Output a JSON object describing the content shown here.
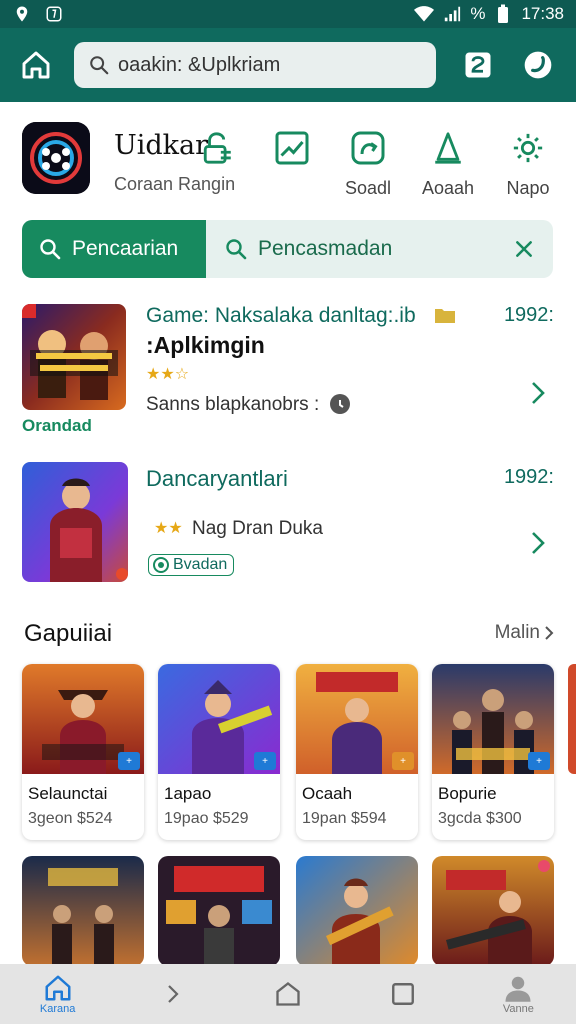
{
  "status_bar": {
    "battery": "%",
    "time": "17:38"
  },
  "appbar": {
    "search_value": "oaakin: &Uplkriam"
  },
  "header": {
    "title": "Uidkar",
    "subtitle": "Coraan Rangin"
  },
  "shortcuts": [
    {
      "label": "",
      "icon": "lock-icon"
    },
    {
      "label": "",
      "icon": "chart-icon"
    },
    {
      "label": "Soadl",
      "icon": "refresh-icon"
    },
    {
      "label": "Aoaah",
      "icon": "triangle-icon"
    },
    {
      "label": "Napo",
      "icon": "settings-icon"
    }
  ],
  "tabs": {
    "active": "Pencaarian",
    "secondary": "Pencasmadan"
  },
  "results": [
    {
      "title": "Game: Naksalaka danltag:.ib",
      "subtitle": ":Aplkimgin",
      "number": "1992:",
      "stars": "★★☆",
      "text": "Sanns blapkanobrs :",
      "badge": "Orandad"
    },
    {
      "title": "Dancaryantlari",
      "number": "1992:",
      "stars": "★★",
      "text": "Nag Dran Duka",
      "chip": "Bvadan"
    }
  ],
  "section": {
    "title": "Gapuiiai",
    "more": "Malin"
  },
  "cards": [
    {
      "name": "Selaunctai",
      "meta": "3geon $524"
    },
    {
      "name": "1apao",
      "meta": "19pao $529"
    },
    {
      "name": "Ocaah",
      "meta": "19pan $594"
    },
    {
      "name": "Bopurie",
      "meta": "3gcda $300"
    }
  ],
  "bottom_nav": {
    "home_label": "Karana",
    "profile_label": "Vanne"
  },
  "colors": {
    "primary": "#0f6a5e",
    "accent": "#178a5f",
    "link": "#1f7ad6"
  }
}
